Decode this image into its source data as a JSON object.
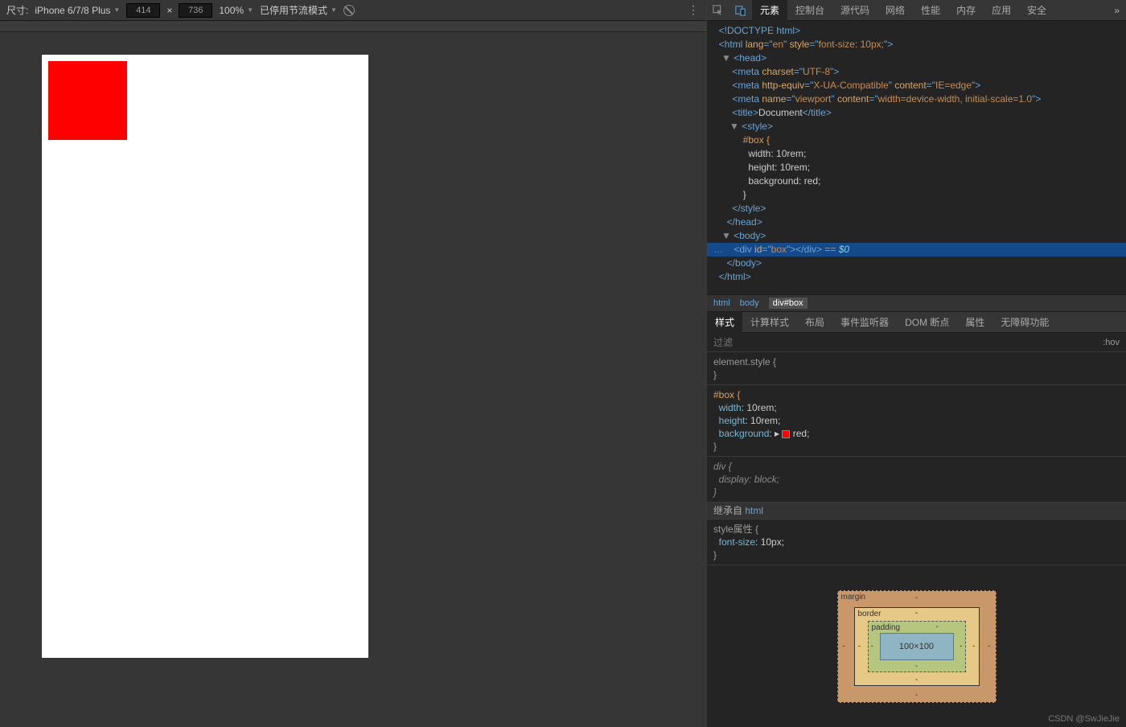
{
  "deviceBar": {
    "sizeLabel": "尺寸:",
    "device": "iPhone 6/7/8 Plus",
    "width": "414",
    "sep": "×",
    "height": "736",
    "zoom": "100%",
    "throttle": "已停用节流模式"
  },
  "devTabs": [
    "元素",
    "控制台",
    "源代码",
    "网络",
    "性能",
    "内存",
    "应用",
    "安全"
  ],
  "devTabsMore": "»",
  "dom": {
    "l1": "<!DOCTYPE html>",
    "l2a": "<html ",
    "l2b": "lang",
    "l2c": "=\"",
    "l2d": "en",
    "l2e": "\" ",
    "l2f": "style",
    "l2g": "=\"",
    "l2h": "font-size: 10px;",
    "l2i": "\">",
    "l3a": "▼",
    "l3b": "<head>",
    "l4a": "<meta ",
    "l4b": "charset",
    "l4c": "=\"",
    "l4d": "UTF-8",
    "l4e": "\">",
    "l5a": "<meta ",
    "l5b": "http-equiv",
    "l5c": "=\"",
    "l5d": "X-UA-Compatible",
    "l5e": "\" ",
    "l5f": "content",
    "l5g": "=\"",
    "l5h": "IE=edge",
    "l5i": "\">",
    "l6a": "<meta ",
    "l6b": "name",
    "l6c": "=\"",
    "l6d": "viewport",
    "l6e": "\" ",
    "l6f": "content",
    "l6g": "=\"",
    "l6h": "width=device-width, initial-scale=1.0",
    "l6i": "\">",
    "l7a": "<title>",
    "l7b": "Document",
    "l7c": "</title>",
    "l8a": "▼",
    "l8b": "<style>",
    "l9": "#box {",
    "l10": "width: 10rem;",
    "l11": "height: 10rem;",
    "l12": "background: red;",
    "l13": "}",
    "l14": "</style>",
    "l15": "</head>",
    "l16a": "▼",
    "l16b": "<body>",
    "l17a": "<div ",
    "l17b": "id",
    "l17c": "=\"",
    "l17d": "box",
    "l17e": "\">",
    "l17f": "</div>",
    "l17g": " == ",
    "l17h": "$0",
    "l18": "</body>",
    "l19": "</html>"
  },
  "breadcrumb": [
    "html",
    "body",
    "div#box"
  ],
  "stylesTabs": [
    "样式",
    "计算样式",
    "布局",
    "事件监听器",
    "DOM 断点",
    "属性",
    "无障碍功能"
  ],
  "filter": {
    "placeholder": "过滤",
    "hov": ":hov"
  },
  "styles": {
    "elStyle": "element.style {",
    "close": "}",
    "boxSel": "#box {",
    "wProp": "width",
    "wVal": ": 10rem;",
    "hProp": "height",
    "hVal": ": 10rem;",
    "bgProp": "background",
    "bgArrow": ": ▸ ",
    "bgVal": "red;",
    "divSel": "div {",
    "dispProp": "display",
    "dispVal": ": block;",
    "inheritLabel": "继承自 ",
    "inheritFrom": "html",
    "styleAttr": "style属性 {",
    "fsProp": "font-size",
    "fsVal": ": 10px;"
  },
  "boxModel": {
    "margin": "margin",
    "border": "border",
    "padding": "padding",
    "content": "100×100",
    "dash": "-"
  },
  "watermark": "CSDN @SwJieJie"
}
